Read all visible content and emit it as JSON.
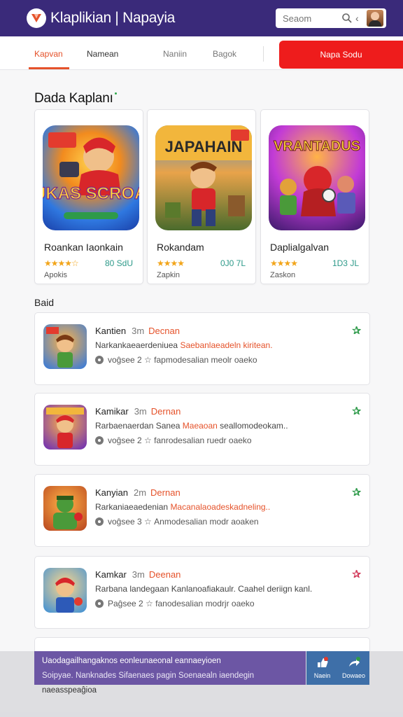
{
  "header": {
    "app_title": "Klaplikian | Napayia",
    "search_placeholder": "Seaom",
    "brand_color": "#3a2a7a",
    "accent_color": "#e5522a"
  },
  "tabs": [
    {
      "label": "Kapvan",
      "active": true
    },
    {
      "label": "Namean",
      "active": false
    },
    {
      "label": "Naniin",
      "active": false
    },
    {
      "label": "Bagok",
      "active": false
    }
  ],
  "cta": {
    "label": "Napa Sodu",
    "color": "#ee1c1c"
  },
  "featured": {
    "title": "Dada Kaplanı",
    "cards": [
      {
        "name": "Roankan Iaonkain",
        "rating_stars": "★★★★☆",
        "meta": "80 SdU",
        "sub": "Apokis",
        "icon": "game-art-zukas-scroan",
        "art_text": "ZUKAS SCROAN"
      },
      {
        "name": "Rokandam",
        "rating_stars": "★★★★",
        "meta": "0J0 7L",
        "sub": "Zapkin",
        "icon": "game-art-japahain",
        "art_text": "JAPAHAIN"
      },
      {
        "name": "Daplialgalvan",
        "rating_stars": "★★★★",
        "meta": "1D3 JL",
        "sub": "Zaskon",
        "icon": "game-art-vrantadus",
        "art_text": "VRANTADUS"
      }
    ]
  },
  "list": {
    "heading": "Baid",
    "items": [
      {
        "title": "Kantien",
        "num": "3m",
        "tag": "Decnan",
        "desc_prefix": "Narkankaeaerdeniuea",
        "desc_highlight": "Saebanlaeadeln kiritean.",
        "meta_prefix": "voĝsee 2",
        "meta_star": "☆",
        "meta_rest": "fapmodesalian meolr oaeko",
        "fav_color": "#2e9a4a"
      },
      {
        "title": "Kamikar",
        "num": "3m",
        "tag": "Dernan",
        "desc_prefix": "Rarbaenaerdan Sanea",
        "desc_highlight": "Maeaoan",
        "desc_suffix": "seallomodeokam..",
        "meta_prefix": "voĝsee 2",
        "meta_star": "☆",
        "meta_rest": "fanrodesalian ruedr oaeko",
        "fav_color": "#2e9a4a"
      },
      {
        "title": "Kanyian",
        "num": "2m",
        "tag": "Dernan",
        "desc_prefix": "Rarkaniaeaedenian",
        "desc_highlight": "Macanalaoadeskadneling..",
        "meta_prefix": "voĝsee 3",
        "meta_star": "☆",
        "meta_rest": "Anmodesalian modr aoaken",
        "fav_color": "#2e9a4a"
      },
      {
        "title": "Kamkar",
        "num": "3m",
        "tag": "Deenan",
        "desc_prefix": "Rarbana landegaan Kanlanoafiakaulr. Caahel deriign kanl.",
        "desc_highlight": "",
        "meta_prefix": "Paĝsee 2",
        "meta_star": "☆",
        "meta_rest": "fanodesalian modrjr oaeko",
        "fav_color": "#d23a5a"
      }
    ]
  },
  "banner": {
    "line1": "Uaodagailhangaknos eonleunaeonal eannaeyioen",
    "line2": "Soipyae. Nanknades Sifaenaes pagin Soenaealn iaendegin",
    "line3": "naeasspeaĝioa",
    "actions": [
      {
        "label": "Naein",
        "icon": "like-icon"
      },
      {
        "label": "Dowaeo",
        "icon": "share-icon"
      }
    ]
  }
}
